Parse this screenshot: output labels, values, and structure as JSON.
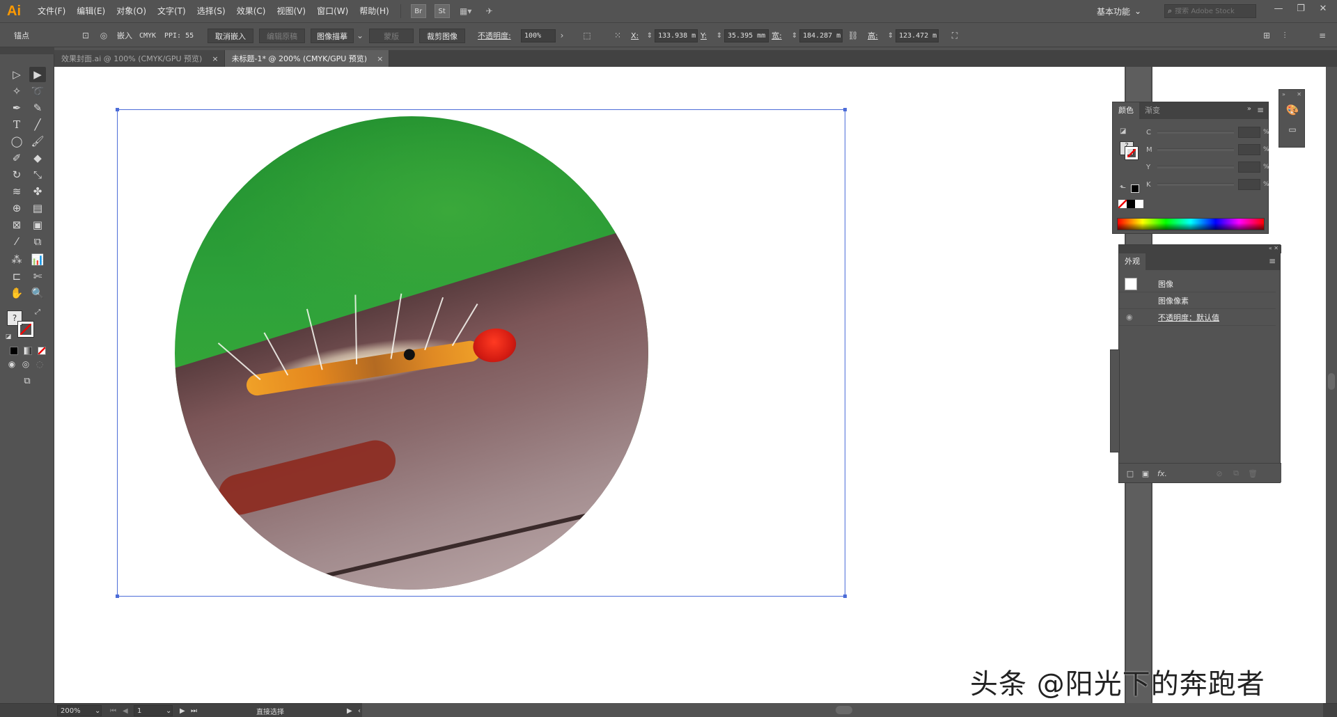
{
  "app": {
    "logo": "Ai"
  },
  "menu": [
    "文件(F)",
    "编辑(E)",
    "对象(O)",
    "文字(T)",
    "选择(S)",
    "效果(C)",
    "视图(V)",
    "窗口(W)",
    "帮助(H)"
  ],
  "menubar_icons": {
    "br": "Br",
    "st": "St"
  },
  "workspace": {
    "label": "基本功能"
  },
  "search": {
    "placeholder": "搜索 Adobe Stock"
  },
  "control_bar": {
    "object_type": "锚点",
    "embed": "嵌入",
    "color_mode": "CMYK",
    "ppi": "PPI: 55",
    "unembed_btn": "取消嵌入",
    "edit_original_btn": "编辑原稿",
    "image_trace_btn": "图像描摹",
    "mask_btn": "蒙版",
    "crop_btn": "裁剪图像",
    "opacity_label": "不透明度:",
    "opacity_value": "100%",
    "x_label": "X:",
    "x_value": "133.938 m",
    "y_label": "Y:",
    "y_value": "35.395 mm",
    "w_label": "宽:",
    "w_value": "184.287 m",
    "h_label": "高:",
    "h_value": "123.472 m"
  },
  "tabs": [
    {
      "label": "效果封面.ai @ 100% (CMYK/GPU 预览)",
      "active": false
    },
    {
      "label": "未标题-1* @ 200% (CMYK/GPU 预览)",
      "active": true
    }
  ],
  "tab_close": "×",
  "color_panel": {
    "tabs": [
      "颜色",
      "渐变"
    ],
    "channels": [
      "C",
      "M",
      "Y",
      "K"
    ],
    "percent": "%"
  },
  "appearance_panel": {
    "title": "外观",
    "rows": [
      "图像",
      "图像像素",
      "不透明度：默认值"
    ],
    "fx": "fx."
  },
  "status_bar": {
    "zoom": "200%",
    "page": "1",
    "tool": "直接选择"
  },
  "watermark": "头条 @阳光下的奔跑者",
  "colors": {
    "accent": "#ff9a00",
    "selection": "#4c6cd8",
    "canvas": "#ffffff",
    "ui": "#535353"
  }
}
